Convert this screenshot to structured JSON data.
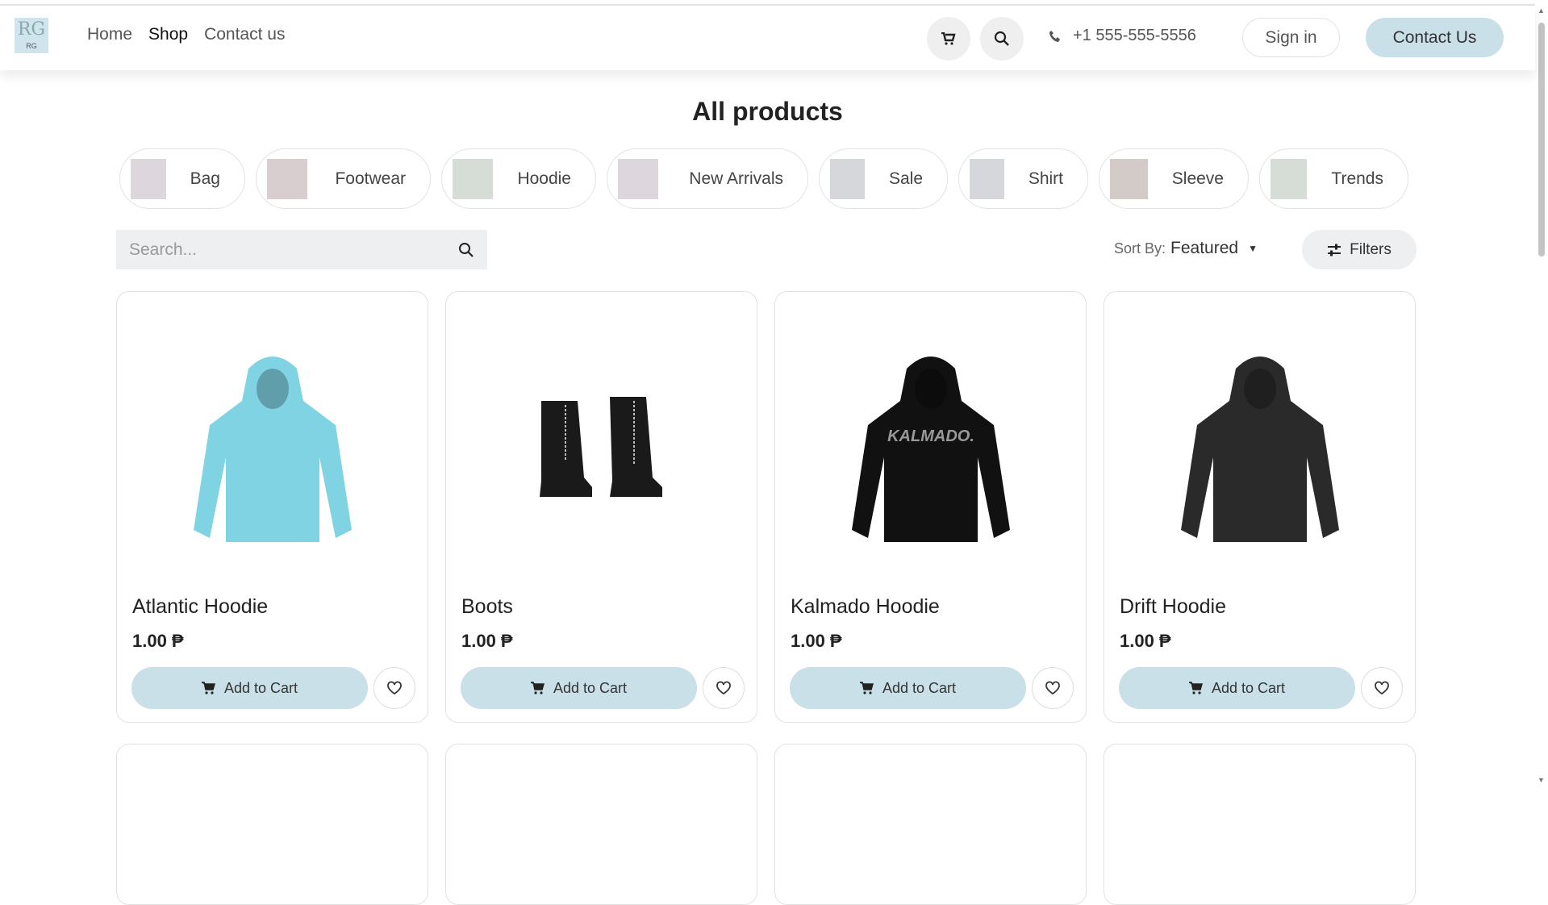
{
  "header": {
    "logo_text": "RG",
    "nav": [
      "Home",
      "Shop",
      "Contact us"
    ],
    "active_nav": "Shop",
    "phone": "+1 555-555-5556",
    "sign_in": "Sign in",
    "contact": "Contact Us"
  },
  "page": {
    "title": "All products"
  },
  "categories": [
    {
      "label": "Bag",
      "color": "#ddd6dc"
    },
    {
      "label": "Footwear",
      "color": "#d8cdcf"
    },
    {
      "label": "Hoodie",
      "color": "#d6ddd6"
    },
    {
      "label": "New Arrivals",
      "color": "#ddd6dc"
    },
    {
      "label": "Sale",
      "color": "#d6d7db"
    },
    {
      "label": "Shirt",
      "color": "#d6d7dc"
    },
    {
      "label": "Sleeve",
      "color": "#d3cbc8"
    },
    {
      "label": "Trends",
      "color": "#d6ddd6"
    }
  ],
  "search": {
    "placeholder": "Search..."
  },
  "sort": {
    "label": "Sort By:",
    "value": "Featured"
  },
  "filters_label": "Filters",
  "products": [
    {
      "name": "Atlantic Hoodie",
      "price": "1.00 ₱",
      "kind": "hoodie",
      "color": "#7fd3e3"
    },
    {
      "name": "Boots",
      "price": "1.00 ₱",
      "kind": "boots",
      "color": "#1a1a1a"
    },
    {
      "name": "Kalmado Hoodie",
      "price": "1.00 ₱",
      "kind": "hoodie",
      "color": "#111111",
      "print": "KALMADO."
    },
    {
      "name": "Drift Hoodie",
      "price": "1.00 ₱",
      "kind": "hoodie",
      "color": "#2a2a2a"
    }
  ],
  "add_to_cart": "Add to Cart",
  "colors": {
    "accent": "#c9e0e8"
  }
}
